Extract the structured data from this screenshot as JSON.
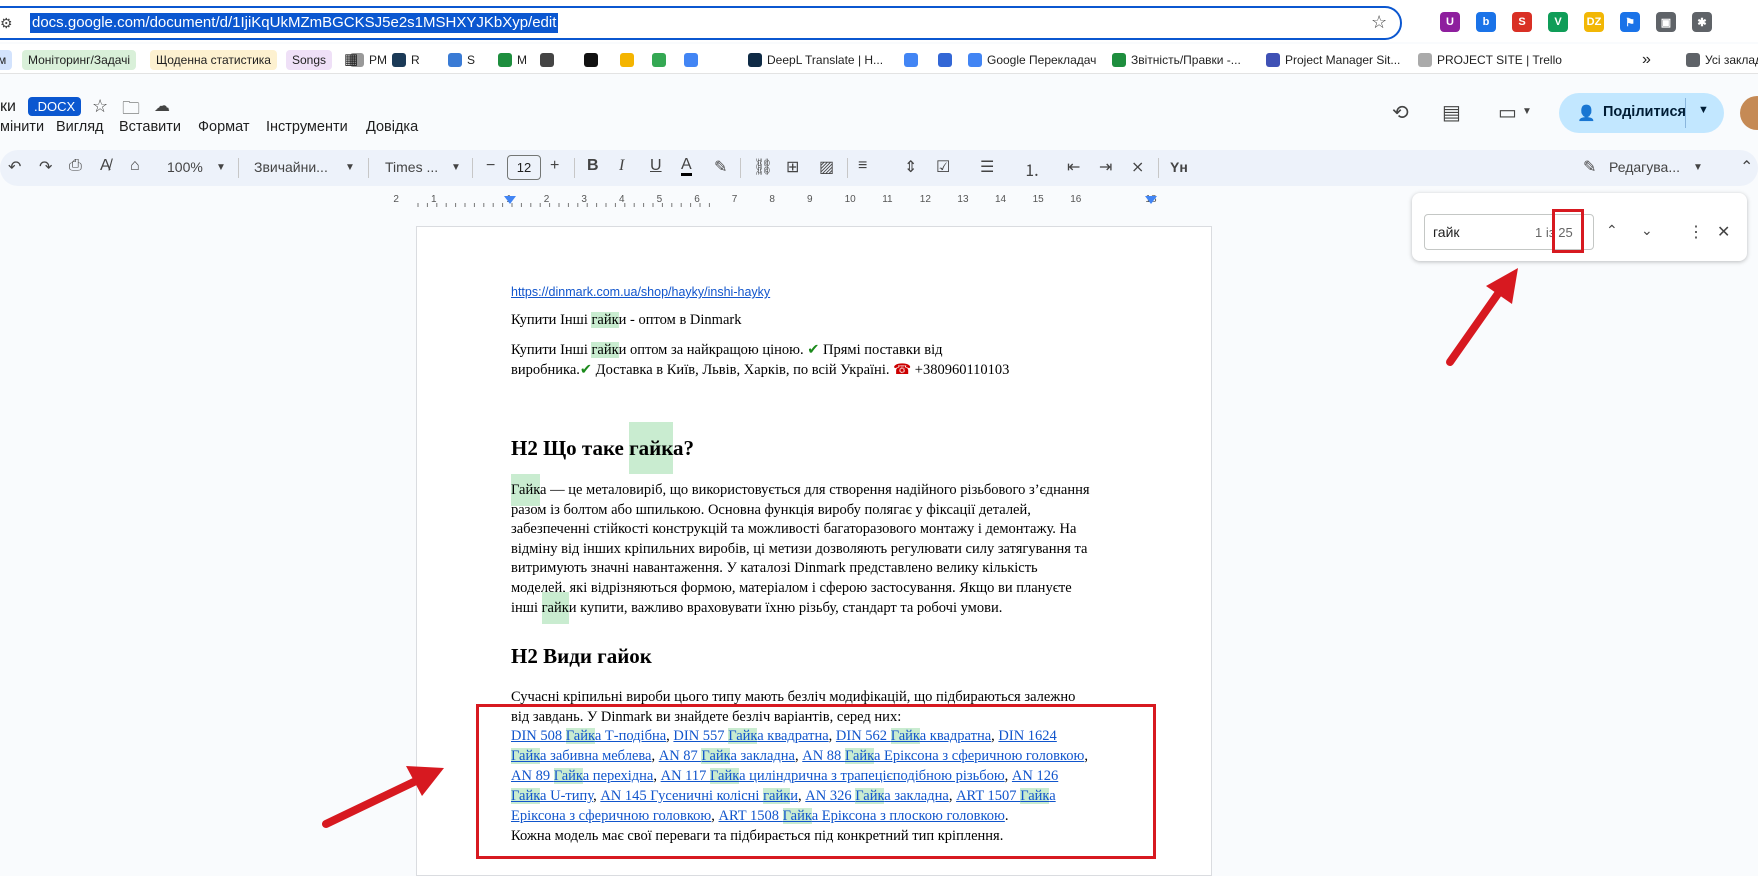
{
  "browser": {
    "url": "docs.google.com/document/d/1IjiKqUkMZmBGCKSJ5e2s1MSHXYJKbXyp/edit",
    "extensions": [
      {
        "name": "ublock-icon",
        "color": "#8e1f9e",
        "glyph": "U"
      },
      {
        "name": "tabs-icon",
        "color": "#1a73e8",
        "glyph": "b"
      },
      {
        "name": "seo-icon",
        "color": "#d93025",
        "glyph": "S"
      },
      {
        "name": "vpn-icon",
        "color": "#0f9d58",
        "glyph": "V"
      },
      {
        "name": "dz-icon",
        "color": "#f2b705",
        "glyph": "DZ"
      },
      {
        "name": "flag-icon",
        "color": "#1a73e8",
        "glyph": "⚑"
      },
      {
        "name": "image-icon",
        "color": "#5f6368",
        "glyph": "▣"
      },
      {
        "name": "puzzle-icon",
        "color": "#5f6368",
        "glyph": "✱"
      }
    ]
  },
  "bookmarks": {
    "items": [
      {
        "label": "м",
        "bg": "#d3e3fd"
      },
      {
        "label": "Моніторинг/Задачі",
        "bg": "#d9f0d9"
      },
      {
        "label": "Щоденна статистика",
        "bg": "#fdf1d0"
      },
      {
        "label": "Songs",
        "bg": "#efe0f7"
      },
      {
        "label": "PM",
        "favicon": "#999"
      },
      {
        "label": "R",
        "favicon": "#1b3a57"
      },
      {
        "label": "S",
        "favicon": "#3a7bd5"
      },
      {
        "label": "M",
        "favicon": "#1e8e3e"
      },
      {
        "label": "",
        "favicon": "#444"
      },
      {
        "label": "",
        "favicon": "#111"
      },
      {
        "label": "",
        "favicon": "#f4b400"
      },
      {
        "label": "",
        "favicon": "#34a853"
      },
      {
        "label": "",
        "favicon": "#4285f4"
      },
      {
        "label": "DeepL Translate | Н...",
        "favicon": "#0f2b46"
      },
      {
        "label": "",
        "favicon": "#4285f4"
      },
      {
        "label": "",
        "favicon": "#3367d6"
      },
      {
        "label": "Google Перекладач",
        "favicon": "#4285f4"
      },
      {
        "label": "Звітність/Правки -...",
        "favicon": "#1e8e3e"
      },
      {
        "label": "Project Manager Sit...",
        "favicon": "#3f51b5"
      },
      {
        "label": "PROJECT SITE | Trello",
        "favicon": "#aaa"
      },
      {
        "label": "Усі заклад",
        "favicon": "#5f6368"
      }
    ],
    "more": "»"
  },
  "docs": {
    "title_fragment": "ки",
    "docx_badge": ".DOCX",
    "menu": [
      "мінити",
      "Вигляд",
      "Вставити",
      "Формат",
      "Інструменти",
      "Довідка"
    ],
    "share_label": "Поділитися",
    "toolbar": {
      "zoom": "100%",
      "style": "Звичайни...",
      "font": "Times ...",
      "font_size": "12",
      "mode": "Редагува..."
    },
    "ruler_labels": [
      "2",
      "1",
      "",
      "1",
      "2",
      "3",
      "4",
      "5",
      "6",
      "7",
      "8",
      "9",
      "10",
      "11",
      "12",
      "13",
      "14",
      "15",
      "16",
      "",
      "18"
    ]
  },
  "find": {
    "query": "гайк",
    "count": "1 із 25"
  },
  "document": {
    "url_link": "https://dinmark.com.ua/shop/hayky/inshi-hayky",
    "line1": {
      "a": "Купити Інші ",
      "hl": "гайк",
      "b": "и - оптом в Dinmark"
    },
    "line2": {
      "a": "Купити Інші ",
      "hl": "гайк",
      "b": "и оптом за найкращою ціною. ",
      "check": "✔",
      "c": " Прямі поставки від"
    },
    "line3": {
      "a": "виробника.",
      "check": "✔",
      "b": " Доставка в Київ, Львів, Харків, по всій Україні. ",
      "phone": "☎",
      "c": " +380960110103"
    },
    "h2_1": {
      "a": "H2 Що таке ",
      "hl": "гайк",
      "b": "а?"
    },
    "para1": [
      {
        "hl": "Гайк",
        "rest": "а — це металовиріб, що використовується для створення надійного різьбового з’єднання"
      },
      {
        "text": "разом із болтом або шпилькою. Основна функція виробу полягає у фіксації деталей,"
      },
      {
        "text": "забезпеченні стійкості конструкцій та можливості багаторазового монтажу і демонтажу. На"
      },
      {
        "text": "відміну від інших кріпильних виробів, ці  метизи дозволяють регулювати силу затягування та"
      },
      {
        "text": "витримують значні навантаження. У каталозі Dinmark представлено велику кількість"
      },
      {
        "text": "моделей, які відрізняються формою, матеріалом і сферою застосування. Якщо ви плануєте"
      },
      {
        "pre": "інші ",
        "hl": "гайк",
        "rest": "и купити, важливо враховувати їхню різьбу, стандарт та робочі умови."
      }
    ],
    "h2_2": "H2 Види гайок",
    "para2": [
      "Сучасні кріпильні вироби цього типу мають безліч модифікацій, що підбираються залежно",
      "від завдань. У Dinmark ви знайдете безліч варіантів, серед них:"
    ],
    "links_lines": [
      [
        {
          "t": "DIN 508 ",
          "l": true
        },
        {
          "t": "Гайк",
          "l": true,
          "h": true
        },
        {
          "t": "а Т-подібна",
          "l": true
        },
        {
          "t": ", "
        },
        {
          "t": "DIN 557 ",
          "l": true
        },
        {
          "t": "Гайк",
          "l": true,
          "h": true
        },
        {
          "t": "а квадратна",
          "l": true
        },
        {
          "t": ", "
        },
        {
          "t": "DIN 562 ",
          "l": true
        },
        {
          "t": "Гайк",
          "l": true,
          "h": true
        },
        {
          "t": "а квадратна",
          "l": true
        },
        {
          "t": ", "
        },
        {
          "t": "DIN 1624",
          "l": true
        }
      ],
      [
        {
          "t": "Гайк",
          "l": true,
          "h": true
        },
        {
          "t": "а забивна меблева",
          "l": true
        },
        {
          "t": ", "
        },
        {
          "t": "AN 87 ",
          "l": true
        },
        {
          "t": "Гайк",
          "l": true,
          "h": true
        },
        {
          "t": "а закладна",
          "l": true
        },
        {
          "t": ", "
        },
        {
          "t": "AN 88 ",
          "l": true
        },
        {
          "t": "Гайк",
          "l": true,
          "h": true
        },
        {
          "t": "а Еріксона з сферичною головкою",
          "l": true
        },
        {
          "t": ","
        }
      ],
      [
        {
          "t": "AN 89 ",
          "l": true
        },
        {
          "t": "Гайк",
          "l": true,
          "h": true
        },
        {
          "t": "а перехідна",
          "l": true
        },
        {
          "t": ", "
        },
        {
          "t": "AN 117 ",
          "l": true
        },
        {
          "t": "Гайк",
          "l": true,
          "h": true
        },
        {
          "t": "а циліндрична з трапецієподібною різьбою",
          "l": true
        },
        {
          "t": ", "
        },
        {
          "t": "AN 126",
          "l": true
        }
      ],
      [
        {
          "t": "Гайк",
          "l": true,
          "h": true
        },
        {
          "t": "а U-типу",
          "l": true
        },
        {
          "t": ", "
        },
        {
          "t": "AN 145 Гусеничні колісні ",
          "l": true
        },
        {
          "t": "гайк",
          "l": true,
          "h": true
        },
        {
          "t": "и",
          "l": true
        },
        {
          "t": ", "
        },
        {
          "t": "AN 326 ",
          "l": true
        },
        {
          "t": "Гайк",
          "l": true,
          "h": true
        },
        {
          "t": "а закладна",
          "l": true
        },
        {
          "t": ", "
        },
        {
          "t": "ART 1507 ",
          "l": true
        },
        {
          "t": "Гайк",
          "l": true,
          "h": true
        },
        {
          "t": "а",
          "l": true
        }
      ],
      [
        {
          "t": "Еріксона з сферичною головкою",
          "l": true
        },
        {
          "t": ", "
        },
        {
          "t": "ART 1508 ",
          "l": true
        },
        {
          "t": "Гайк",
          "l": true,
          "h": true
        },
        {
          "t": "а Еріксона з плоскою головкою",
          "l": true
        },
        {
          "t": "."
        }
      ]
    ],
    "closing": "Кожна модель має свої переваги та підбирається під конкретний тип кріплення."
  }
}
